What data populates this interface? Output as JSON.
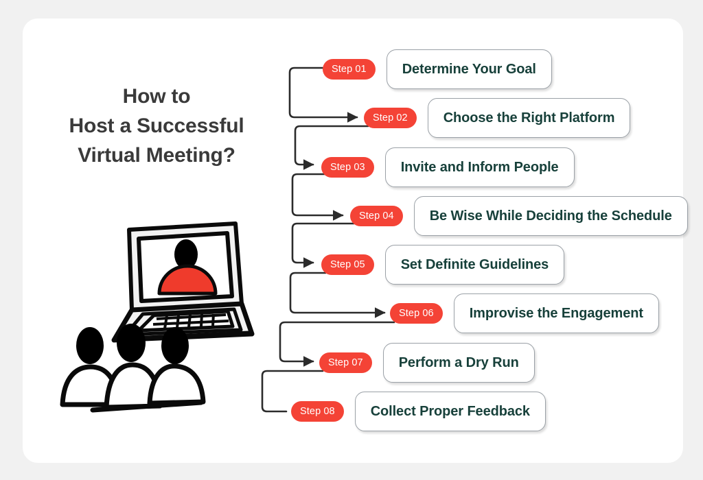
{
  "page": {
    "background_color": "#f1f1f1",
    "card_color": "#ffffff"
  },
  "headline": {
    "line1": "How to",
    "line2": "Host a Successful",
    "line3": "Virtual Meeting?",
    "color": "#3a3a3a"
  },
  "illustration": {
    "name": "laptop-video-call-with-audience",
    "screen_avatar_head_color": "#000000",
    "screen_avatar_body_color": "#ef3b2c",
    "outline_color": "#000000",
    "laptop_body_color": "#f2f2f2"
  },
  "theme": {
    "badge_color": "#f44336",
    "badge_text_color": "#ffffff",
    "box_text_color": "#17403a",
    "box_border_color": "#9aa0a6",
    "connector_color": "#2b2b2b"
  },
  "steps": [
    {
      "badge": "Step 01",
      "label": "Determine Your Goal"
    },
    {
      "badge": "Step 02",
      "label": "Choose the Right Platform"
    },
    {
      "badge": "Step 03",
      "label": "Invite and Inform People"
    },
    {
      "badge": "Step 04",
      "label": "Be Wise While Deciding the Schedule"
    },
    {
      "badge": "Step 05",
      "label": "Set Definite Guidelines"
    },
    {
      "badge": "Step 06",
      "label": "Improvise the Engagement"
    },
    {
      "badge": "Step 07",
      "label": "Perform a Dry Run"
    },
    {
      "badge": "Step 08",
      "label": "Collect Proper Feedback"
    }
  ]
}
